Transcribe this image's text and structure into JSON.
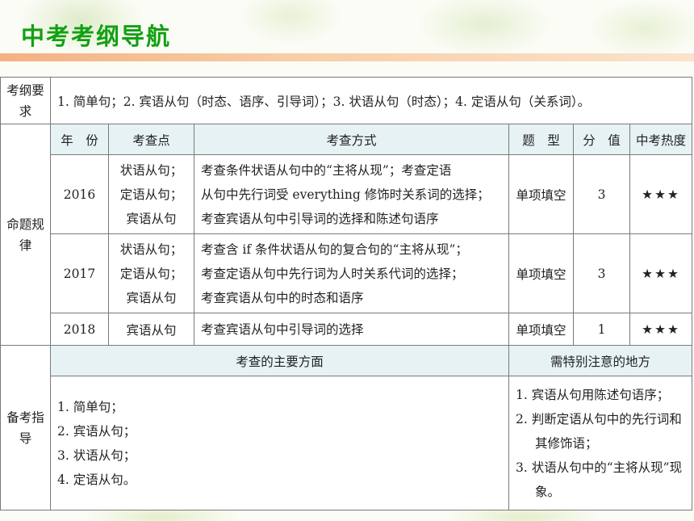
{
  "title": "中考考纲导航",
  "requirement": {
    "label": "考纲要求",
    "text": "1. 简单句；2. 宾语从句（时态、语序、引导词）；3. 状语从句（时态）；4. 定语从句（关系词）。"
  },
  "rules": {
    "label": "命题规律",
    "headers": [
      "年　份",
      "考查点",
      "考查方式",
      "题　型",
      "分　值",
      "中考热度"
    ],
    "rows": [
      {
        "year": "2016",
        "points": [
          "状语从句；",
          "定语从句；",
          "宾语从句"
        ],
        "method": [
          "考查条件状语从句中的“主将从现”；考查定语",
          "从句中先行词受 everything 修饰时关系词的选择；",
          "考查宾语从句中引导词的选择和陈述句语序"
        ],
        "type": "单项填空",
        "score": "3",
        "heat": "★★★"
      },
      {
        "year": "2017",
        "points": [
          "状语从句；",
          "定语从句；",
          "宾语从句"
        ],
        "method": [
          "考查含 if 条件状语从句的复合句的“主将从现”；",
          "考查定语从句中先行词为人时关系代词的选择；",
          "考查宾语从句中的时态和语序"
        ],
        "type": "单项填空",
        "score": "3",
        "heat": "★★★"
      },
      {
        "year": "2018",
        "points": [
          "宾语从句"
        ],
        "method": [
          "考查宾语从句中引导词的选择"
        ],
        "type": "单项填空",
        "score": "1",
        "heat": "★★★"
      }
    ]
  },
  "guide": {
    "label": "备考指导",
    "aspects_header": "考查的主要方面",
    "notes_header": "需特别注意的地方",
    "aspects": [
      "1. 简单句；",
      "2. 宾语从句；",
      "3. 状语从句；",
      "4. 定语从句。"
    ],
    "notes": [
      "1. 宾语从句用陈述句语序；",
      "2. 判断定语从句中的先行词和其修饰语；",
      "3. 状语从句中的“主将从现”现象。"
    ]
  }
}
